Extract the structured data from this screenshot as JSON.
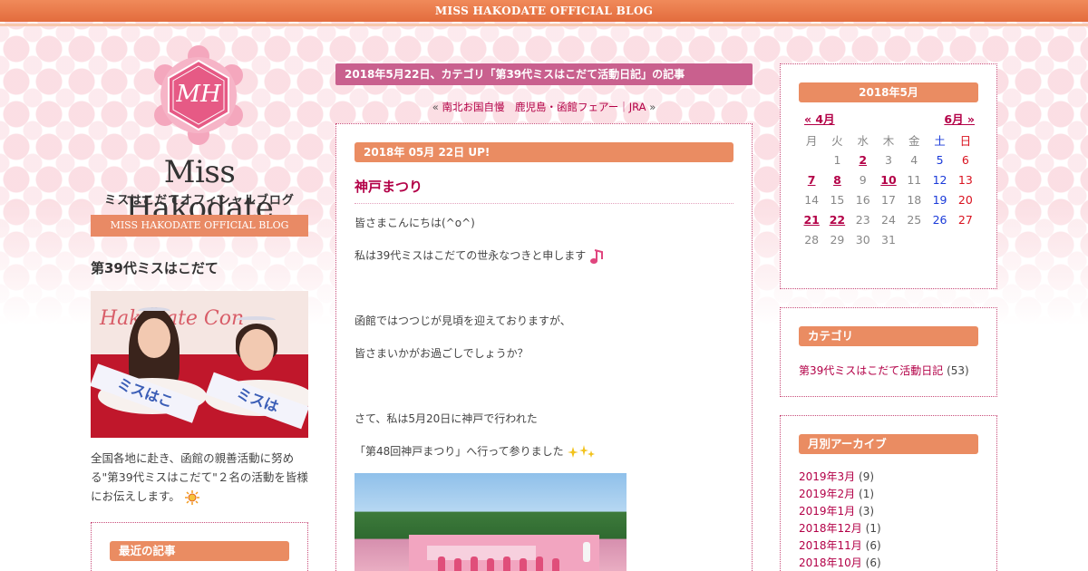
{
  "top_bar": {
    "title": "MISS HAKODATE OFFICIAL BLOG"
  },
  "logo": {
    "monogram": "MH",
    "title": "Miss Hakodate",
    "subtitle": "ミスはこだてオフィシャルブログ",
    "banner": "MISS HAKODATE OFFICIAL BLOG"
  },
  "left": {
    "heading": "第39代ミスはこだて",
    "description": "全国各地に赴き、函館の親善活動に努める\"第39代ミスはこだて\"２名の活動を皆様にお伝えします。",
    "recent_title": "最近の記事"
  },
  "center": {
    "page_title": "2018年5月22日、カテゴリ「第39代ミスはこだて活動日記」の記事",
    "pager": {
      "prev_mark": "«",
      "prev_label": "南北お国自慢　鹿児島・函館フェアー｜JRA",
      "next_mark": "»"
    },
    "post": {
      "date": "2018年 05月 22日 UP!",
      "title": "神戸まつり",
      "lines": [
        "皆さまこんにちは(^o^)",
        "",
        "私は39代ミスはこだての世永なつきと申します",
        "",
        "",
        "",
        "函館ではつつじが見頃を迎えておりますが、",
        "",
        "皆さまいかがお過ごしでしょうか？",
        "",
        "",
        "",
        "さて、私は5月20日に神戸で行われた",
        "",
        "「第48回神戸まつり」へ行って参りました"
      ]
    }
  },
  "calendar": {
    "month": "2018年5月",
    "prev": "« 4月",
    "next": "6月 »",
    "weekdays": [
      "月",
      "火",
      "水",
      "木",
      "金",
      "土",
      "日"
    ],
    "weeks": [
      [
        "",
        "1",
        "2",
        "3",
        "4",
        "5",
        "6"
      ],
      [
        "7",
        "8",
        "9",
        "10",
        "11",
        "12",
        "13"
      ],
      [
        "14",
        "15",
        "16",
        "17",
        "18",
        "19",
        "20"
      ],
      [
        "21",
        "22",
        "23",
        "24",
        "25",
        "26",
        "27"
      ],
      [
        "28",
        "29",
        "30",
        "31",
        "",
        "",
        ""
      ]
    ],
    "linked_days": [
      "2",
      "7",
      "8",
      "10",
      "21",
      "22"
    ]
  },
  "categories": {
    "title": "カテゴリ",
    "items": [
      {
        "label": "第39代ミスはこだて活動日記",
        "count": "(53)"
      }
    ]
  },
  "archives": {
    "title": "月別アーカイブ",
    "items": [
      {
        "label": "2019年3月",
        "count": "(9)"
      },
      {
        "label": "2019年2月",
        "count": "(1)"
      },
      {
        "label": "2019年1月",
        "count": "(3)"
      },
      {
        "label": "2018年12月",
        "count": "(1)"
      },
      {
        "label": "2018年11月",
        "count": "(6)"
      },
      {
        "label": "2018年10月",
        "count": "(6)"
      }
    ]
  },
  "colors": {
    "accent_orange": "#ea8c62",
    "accent_pink": "#c9608e",
    "link": "#b30047",
    "saturday": "#1a3ad9",
    "sunday": "#d9121f"
  }
}
